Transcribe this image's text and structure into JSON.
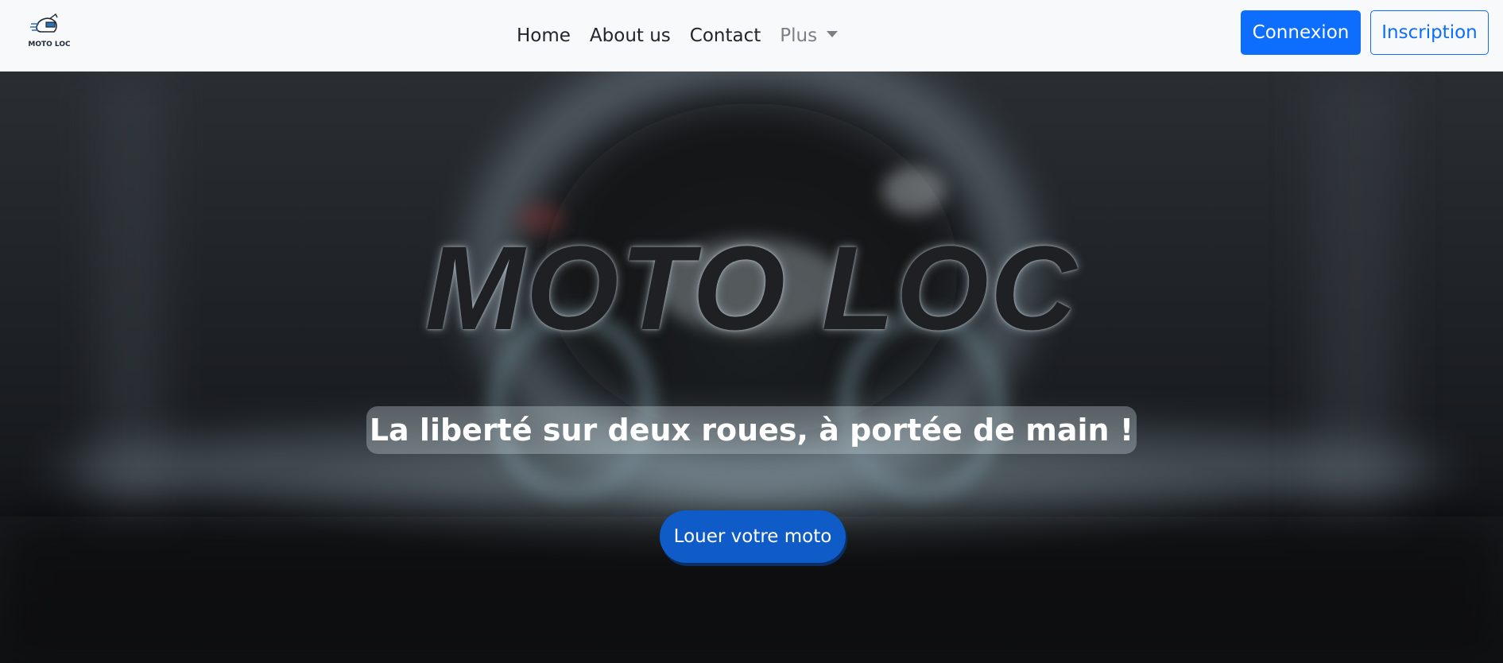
{
  "navbar": {
    "brand": {
      "logo_text": "MOTO LOC",
      "icon": "motorcycle-helmet-logo"
    },
    "links": [
      {
        "label": "Home"
      },
      {
        "label": "About us"
      },
      {
        "label": "Contact"
      },
      {
        "label": "Plus",
        "icon": "caret-down-icon"
      }
    ],
    "login_label": "Connexion",
    "signup_label": "Inscription"
  },
  "hero": {
    "title": "MOTO LOC",
    "tagline": "La liberté sur deux roues, à portée de main !",
    "cta_label": "Louer votre moto"
  },
  "colors": {
    "navbar_bg": "#f8f9fa",
    "primary": "#0d6efd",
    "cta": "#0f5bc8",
    "title_text": "#1e2024"
  }
}
